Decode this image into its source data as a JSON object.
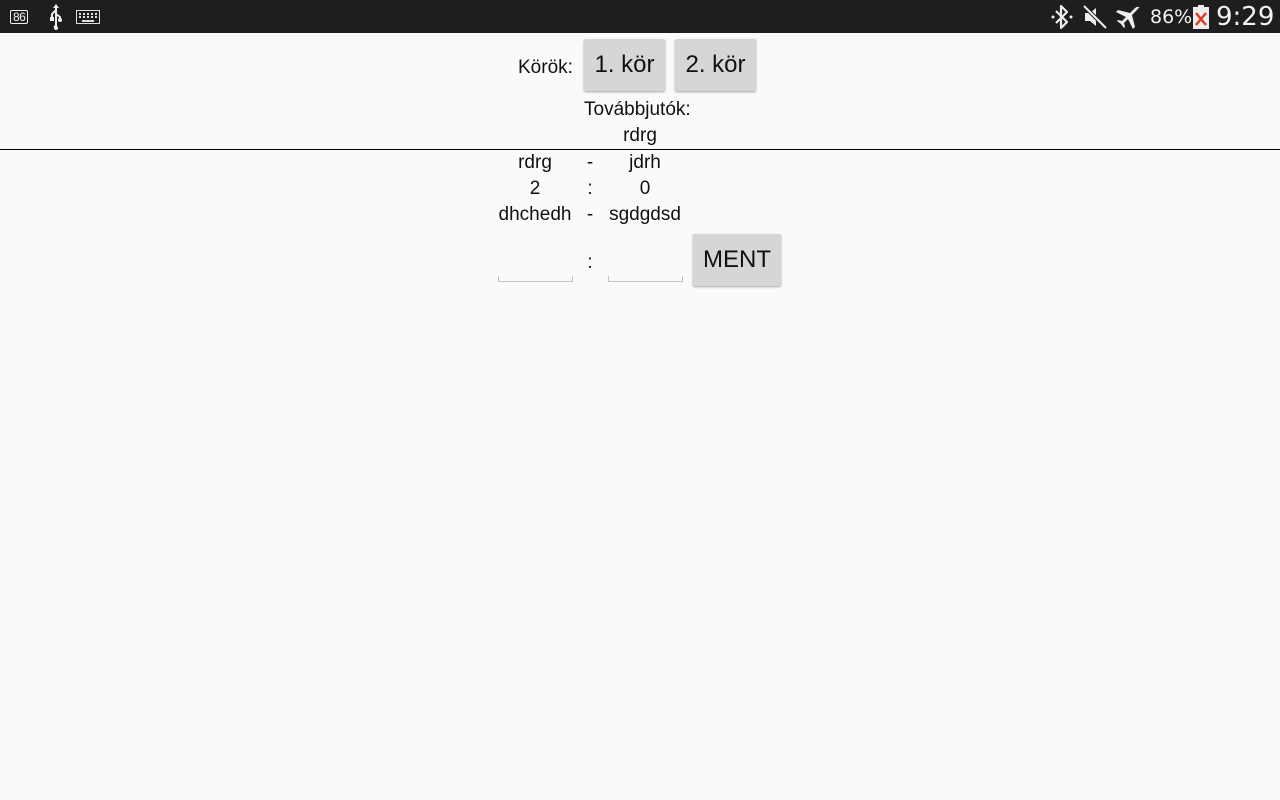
{
  "status_bar": {
    "notification_badge": "86",
    "icons": [
      "notification-86-icon",
      "usb-icon",
      "keyboard-icon",
      "bluetooth-icon",
      "mute-icon",
      "airplane-mode-icon",
      "battery-icon"
    ],
    "battery_percent": "86%",
    "clock": "9:29"
  },
  "rounds": {
    "label": "Körök:",
    "buttons": [
      "1. kör",
      "2. kör"
    ]
  },
  "advancing": {
    "label": "Továbbjutók:",
    "names": [
      "rdrg"
    ]
  },
  "matches": [
    {
      "home": "rdrg",
      "separator": "-",
      "away": "jdrh"
    },
    {
      "home": "2",
      "separator": ":",
      "away": "0"
    },
    {
      "home": "dhchedh",
      "separator": "-",
      "away": "sgdgdsd"
    }
  ],
  "score_entry": {
    "separator": ":",
    "home_value": "",
    "away_value": "",
    "save_label": "MENT"
  },
  "colors": {
    "status_bar_bg": "#1e1e1e",
    "background": "#fafafa",
    "button_bg": "#d6d6d6",
    "battery_alert": "#e03a1e"
  }
}
